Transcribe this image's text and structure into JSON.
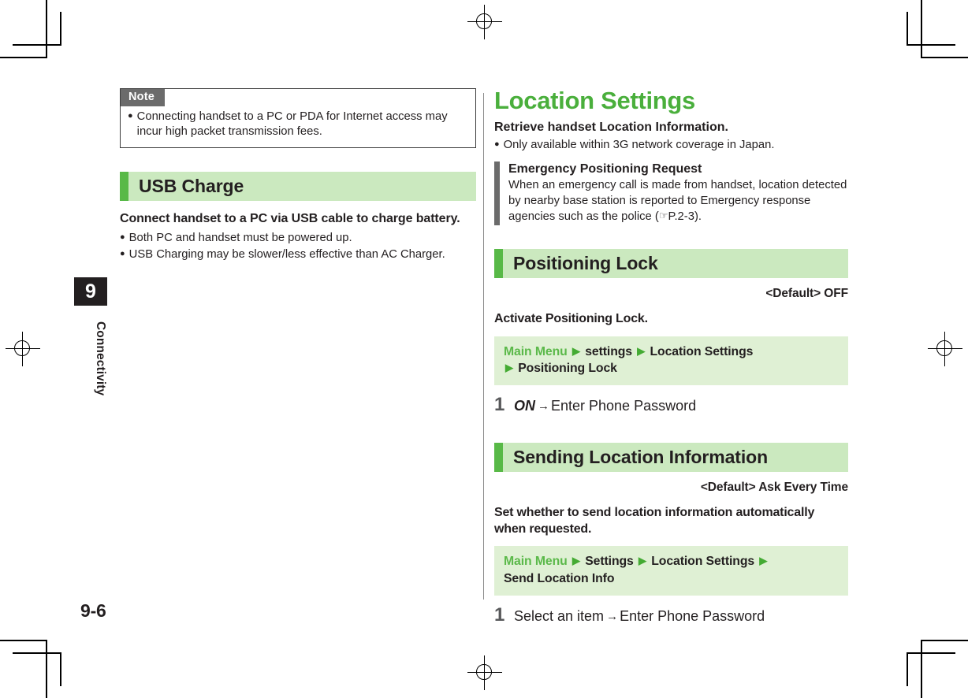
{
  "page": {
    "folio": "9-6",
    "chapter_number": "9",
    "chapter_label": "Connectivity"
  },
  "left_column": {
    "note_box": {
      "tab_label": "Note",
      "bullets": [
        "Connecting handset to a PC or PDA for Internet access may incur high packet transmission fees."
      ]
    },
    "section": {
      "heading": "USB Charge",
      "lead": "Connect handset to a PC via USB cable to charge battery.",
      "bullets": [
        "Both PC and handset must be powered up.",
        "USB Charging may be slower/less effective than AC Charger."
      ]
    }
  },
  "right_column": {
    "title": "Location Settings",
    "subtitle": "Retrieve handset Location Information.",
    "bullets": [
      "Only available within 3G network coverage in Japan."
    ],
    "callout": {
      "heading": "Emergency Positioning Request",
      "text_before_ref": "When an emergency call is made from handset, location detected by nearby base station is reported to Emergency response agencies such as the police (",
      "ref_icon": "pointing-hand-icon",
      "ref": "P.2-3",
      "text_after_ref": ")."
    },
    "sections": [
      {
        "heading": "Positioning Lock",
        "default_label": "<Default>",
        "default_value": "OFF",
        "description": "Activate Positioning Lock.",
        "path": {
          "root": "Main Menu",
          "items": [
            "settings",
            "Location Settings",
            "Positioning Lock"
          ]
        },
        "steps": [
          {
            "number": "1",
            "key": "ON",
            "arrow": "→",
            "text": "Enter Phone Password"
          }
        ]
      },
      {
        "heading": "Sending Location Information",
        "default_label": "<Default>",
        "default_value": "Ask Every Time",
        "description": "Set whether to send location information automatically when requested.",
        "path": {
          "root": "Main Menu",
          "items": [
            "Settings",
            "Location Settings",
            "Send Location Info"
          ]
        },
        "steps": [
          {
            "number": "1",
            "key": "",
            "arrow": "→",
            "text_lead": "Select an item",
            "text": "Enter Phone Password"
          }
        ]
      }
    ]
  },
  "colors": {
    "brand_green": "#4aaf3c",
    "heading_bar_green": "#58b947",
    "heading_bg_green": "#cbe9bf",
    "path_bg_green": "#dff0d4",
    "note_tab_gray": "#6b6b6b",
    "callout_bar_gray": "#6b6b6b",
    "text_black": "#231f20"
  },
  "icons": {
    "bullet": "●",
    "path_arrow": "▶",
    "step_arrow": "→",
    "reference_hand": "☞"
  }
}
